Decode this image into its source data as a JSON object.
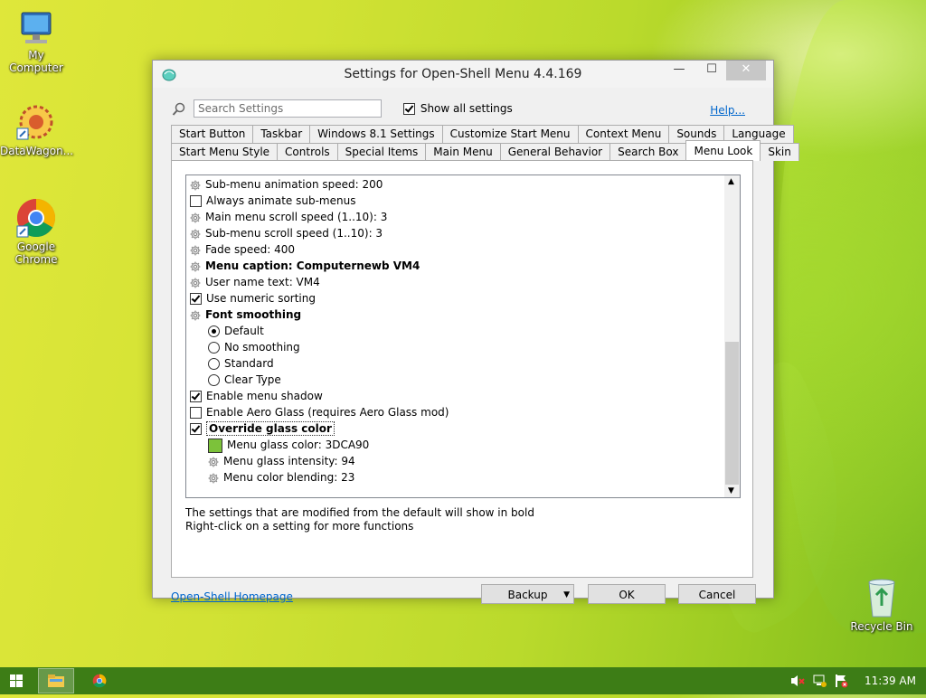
{
  "desktop": {
    "icons": [
      {
        "label": "My Computer",
        "icon": "computer-icon"
      },
      {
        "label": "DataWagon...",
        "icon": "datawagon-icon"
      },
      {
        "label": "Google Chrome",
        "icon": "chrome-icon"
      },
      {
        "label": "Recycle Bin",
        "icon": "recycle-bin-icon"
      }
    ]
  },
  "window": {
    "title": "Settings for Open-Shell Menu 4.4.169",
    "controls": {
      "minimize": "—",
      "maximize": "☐",
      "close": "✕"
    },
    "search": {
      "placeholder": "Search Settings",
      "icon": "search-icon"
    },
    "show_all": {
      "label": "Show all settings",
      "checked": true
    },
    "help": "Help...",
    "tabs_row1": [
      "Start Button",
      "Taskbar",
      "Windows 8.1 Settings",
      "Customize Start Menu",
      "Context Menu",
      "Sounds",
      "Language"
    ],
    "tabs_row2": [
      "Start Menu Style",
      "Controls",
      "Special Items",
      "Main Menu",
      "General Behavior",
      "Search Box",
      "Menu Look",
      "Skin"
    ],
    "active_tab": "Menu Look",
    "settings": [
      {
        "type": "gear",
        "label": "Sub-menu animation speed: 200"
      },
      {
        "type": "checkbox",
        "checked": false,
        "label": "Always animate sub-menus"
      },
      {
        "type": "gear",
        "label": "Main menu scroll speed (1..10): 3"
      },
      {
        "type": "gear",
        "label": "Sub-menu scroll speed (1..10): 3"
      },
      {
        "type": "gear",
        "label": "Fade speed: 400"
      },
      {
        "type": "gear",
        "label": "Menu caption: Computernewb VM4",
        "bold": true
      },
      {
        "type": "gear",
        "label": "User name text: VM4"
      },
      {
        "type": "checkbox",
        "checked": true,
        "label": "Use numeric sorting"
      },
      {
        "type": "gear",
        "label": "Font smoothing",
        "bold": true
      },
      {
        "type": "radio",
        "checked": true,
        "label": "Default",
        "indent": 1
      },
      {
        "type": "radio",
        "checked": false,
        "label": "No smoothing",
        "indent": 1
      },
      {
        "type": "radio",
        "checked": false,
        "label": "Standard",
        "indent": 1
      },
      {
        "type": "radio",
        "checked": false,
        "label": "Clear Type",
        "indent": 1
      },
      {
        "type": "checkbox",
        "checked": true,
        "label": "Enable menu shadow"
      },
      {
        "type": "checkbox",
        "checked": false,
        "label": "Enable Aero Glass (requires Aero Glass mod)"
      },
      {
        "type": "checkbox",
        "checked": true,
        "label": "Override glass color",
        "bold": true,
        "selected": true
      },
      {
        "type": "color",
        "label": "Menu glass color: 3DCA90",
        "color": "#7cc23a",
        "indent": 1
      },
      {
        "type": "gear",
        "label": "Menu glass intensity: 94",
        "indent": 1
      },
      {
        "type": "gear",
        "label": "Menu color blending: 23",
        "indent": 1
      }
    ],
    "notes": [
      "The settings that are modified from the default will show in bold",
      "Right-click on a setting for more functions"
    ],
    "homepage": "Open-Shell Homepage",
    "buttons": {
      "backup": "Backup",
      "ok": "OK",
      "cancel": "Cancel"
    }
  },
  "taskbar": {
    "start_icon": "windows-logo-icon",
    "pinned": [
      "file-explorer-icon",
      "chrome-icon"
    ],
    "tray_icons": [
      "volume-muted-icon",
      "network-icon",
      "action-center-icon"
    ],
    "clock": "11:39 AM",
    "color": "#3d7d16"
  }
}
